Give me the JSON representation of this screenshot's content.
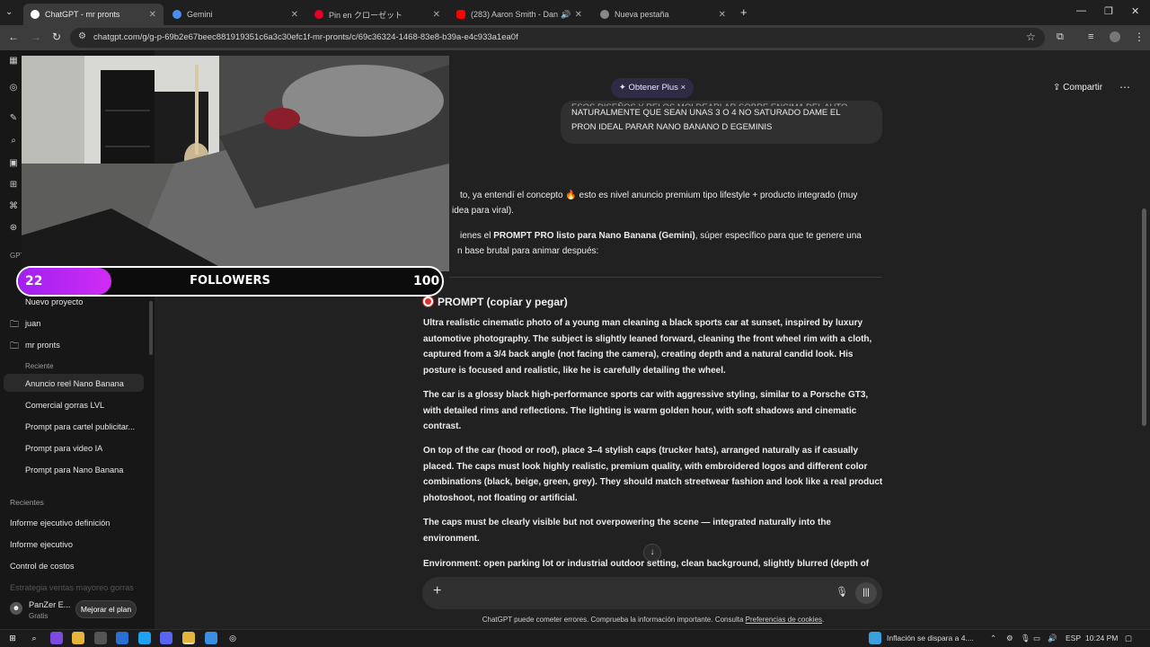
{
  "browser": {
    "tabs": [
      {
        "title": "ChatGPT - mr pronts",
        "active": true
      },
      {
        "title": "Gemini",
        "active": false
      },
      {
        "title": "Pin en クローゼット",
        "active": false
      },
      {
        "title": "(283) Aaron Smith - Dancin",
        "active": false
      },
      {
        "title": "Nueva pestaña",
        "active": false
      }
    ],
    "url": "chatgpt.com/g/g-p-69b2e67beec881919351c6a3c30efc1f-mr-pronts/c/69c36324-1468-83e8-b39a-e4c933a1ea0f"
  },
  "sidebar": {
    "nuevo_proyecto": "Nuevo proyecto",
    "projects": [
      "juan",
      "mr pronts"
    ],
    "reciente_label": "Reciente",
    "recent_chats": [
      "Anuncio reel Nano Banana",
      "Comercial gorras LVL",
      "Prompt para cartel publicitar...",
      "Prompt para video IA",
      "Prompt para Nano Banana"
    ],
    "recientes_label": "Recientes",
    "recientes": [
      "Informe ejecutivo definición",
      "Informe ejecutivo",
      "Control de costos",
      "Estrategia ventas mayoreo gorras"
    ],
    "user_name": "PanZer E...",
    "user_plan": "Gratis",
    "upgrade": "Mejorar el plan",
    "gpt_label": "GPT"
  },
  "overlay": {
    "followers_label": "FOLLOWERS",
    "current": "22",
    "goal": "100",
    "progress_fraction": 0.22
  },
  "header": {
    "obtener_plus": "Obtener Plus",
    "share": "Compartir"
  },
  "chat": {
    "user_msg_line1": "ESOS DISEÑOS Y RELOS MOLDEARLAR SOBRE ENCIMA DEL AUTO",
    "user_msg_line2": "NATURALMENTE QUE SEAN UNAS 3 O 4 NO SATURADO DAME EL",
    "user_msg_line3": "PRON IDEAL PARAR NANO BANANO D EGEMINIS",
    "reply1_line1": "to, ya entendí el concepto 🔥 esto es nivel anuncio premium tipo lifestyle + producto integrado (muy",
    "reply1_line2": "idea para viral).",
    "reply2_prefix": "ienes el ",
    "reply2_bold": "PROMPT PRO listo para Nano Banana (Gemini)",
    "reply2_suffix": ", súper específico para que te genere una",
    "reply2_line2": "n base brutal para animar después:",
    "prompt_title": "PROMPT (copiar y pegar)",
    "p1": "Ultra realistic cinematic photo of a young man cleaning a black sports car at sunset, inspired by luxury automotive photography. The subject is slightly leaned forward, cleaning the front wheel rim with a cloth, captured from a 3/4 back angle (not facing the camera), creating depth and a natural candid look. His posture is focused and realistic, like he is carefully detailing the wheel.",
    "p2": "The car is a glossy black high-performance sports car with aggressive styling, similar to a Porsche GT3, with detailed rims and reflections. The lighting is warm golden hour, with soft shadows and cinematic contrast.",
    "p3": "On top of the car (hood or roof), place 3–4 stylish caps (trucker hats), arranged naturally as if casually placed. The caps must look highly realistic, premium quality, with embroidered logos and different color combinations (black, beige, green, grey). They should match streetwear fashion and look like a real product photoshoot, not floating or artificial.",
    "p4": "The caps must be clearly visible but not overpowering the scene — integrated naturally into the environment.",
    "p5": "Environment: open parking lot or industrial outdoor setting, clean background, slightly blurred (depth of"
  },
  "composer": {
    "disclaimer": "ChatGPT puede cometer errores. Comprueba la información importante. Consulta ",
    "disclaimer_link": "Preferencias de cookies",
    "disclaimer_end": "."
  },
  "taskbar": {
    "news": "Inflación se dispara a 4....",
    "lang": "ESP",
    "time": "10:24 PM"
  }
}
